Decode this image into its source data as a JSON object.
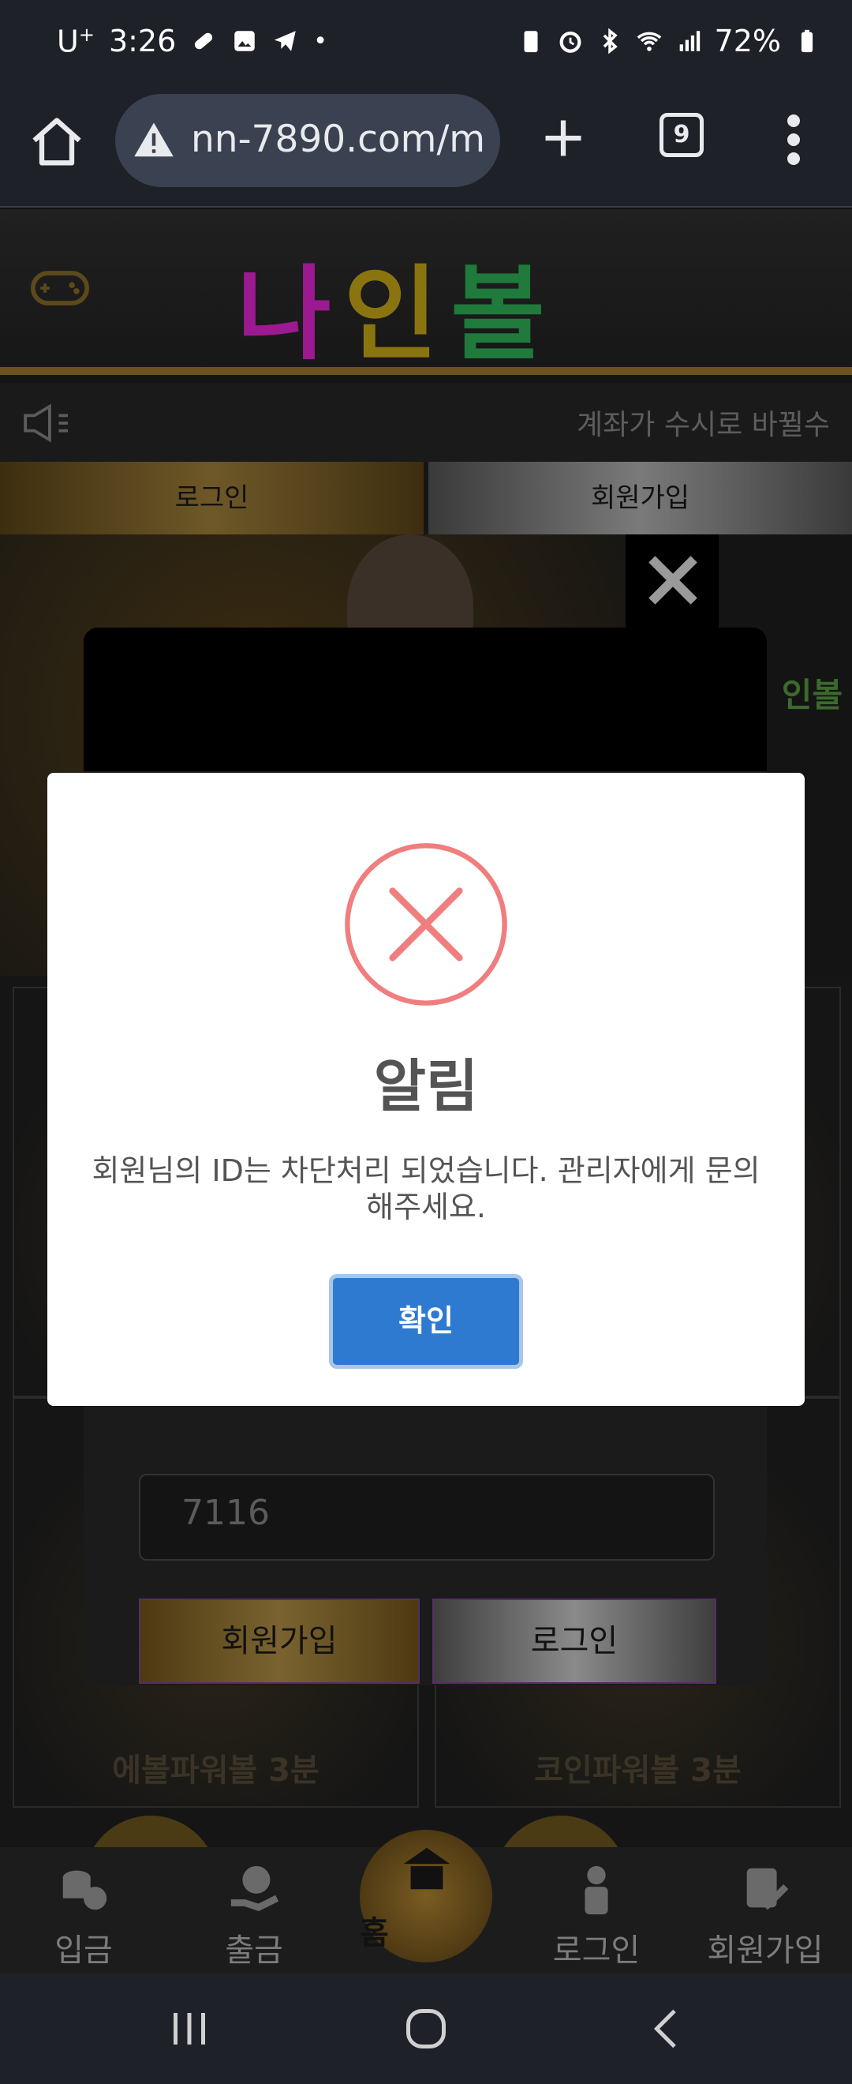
{
  "status_bar": {
    "carrier": "U",
    "carrier_sup": "+",
    "time": "3:26",
    "battery": "72%"
  },
  "browser": {
    "url": "nn-7890.com/m",
    "tab_count": "9"
  },
  "site": {
    "logo": [
      "나",
      "인",
      "볼"
    ],
    "notice": "계좌가 수시로 바뀔수",
    "auth_tabs": [
      "로그인",
      "회원가입"
    ],
    "banner_side_text": "인볼",
    "grid_captions": [
      "에볼파워볼 3분",
      "코인파워볼 3분"
    ]
  },
  "login_dialog": {
    "password_value": "7116",
    "join_label": "회원가입",
    "login_label": "로그인"
  },
  "bottom_nav": {
    "deposit": "입금",
    "withdraw": "출금",
    "home": "홈",
    "login": "로그인",
    "register": "회원가입"
  },
  "alert": {
    "title": "알림",
    "message": "회원님의 ID는 차단처리 되었습니다. 관리자에게 문의해주세요.",
    "confirm_label": "확인",
    "icon": "error-x-icon",
    "confirm_color": "#2e7ad1",
    "error_color": "#f07e7e"
  }
}
